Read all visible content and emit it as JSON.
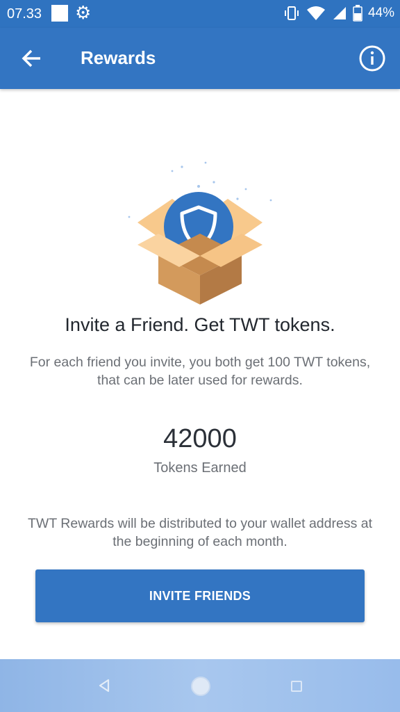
{
  "status_bar": {
    "time": "07.33",
    "battery": "44%",
    "icons": [
      "notification-square-icon",
      "gear-icon",
      "vibrate-icon",
      "wifi-icon",
      "signal-icon",
      "battery-icon"
    ]
  },
  "app_bar": {
    "title": "Rewards",
    "back_icon": "arrow-left-icon",
    "info_icon": "info-circle-icon"
  },
  "hero": {
    "icon": "gift-box-shield-icon",
    "colors": {
      "shield_bg": "#3375c2",
      "box_light": "#f8c98c",
      "box_mid": "#d39a5c",
      "box_dark": "#b37a45"
    }
  },
  "content": {
    "headline": "Invite a Friend. Get TWT tokens.",
    "subtext": "For each friend you invite, you both get 100 TWT tokens, that can be later used for rewards.",
    "tokens_value": "42000",
    "tokens_label": "Tokens Earned",
    "notice": "TWT Rewards will be distributed to your wallet address at the beginning of each month."
  },
  "actions": {
    "invite_label": "INVITE FRIENDS"
  },
  "nav_bar": {
    "icons": [
      "nav-back-icon",
      "nav-home-icon",
      "nav-recent-icon"
    ]
  },
  "theme": {
    "primary": "#3375c2",
    "statusbar": "#2f73c0"
  }
}
